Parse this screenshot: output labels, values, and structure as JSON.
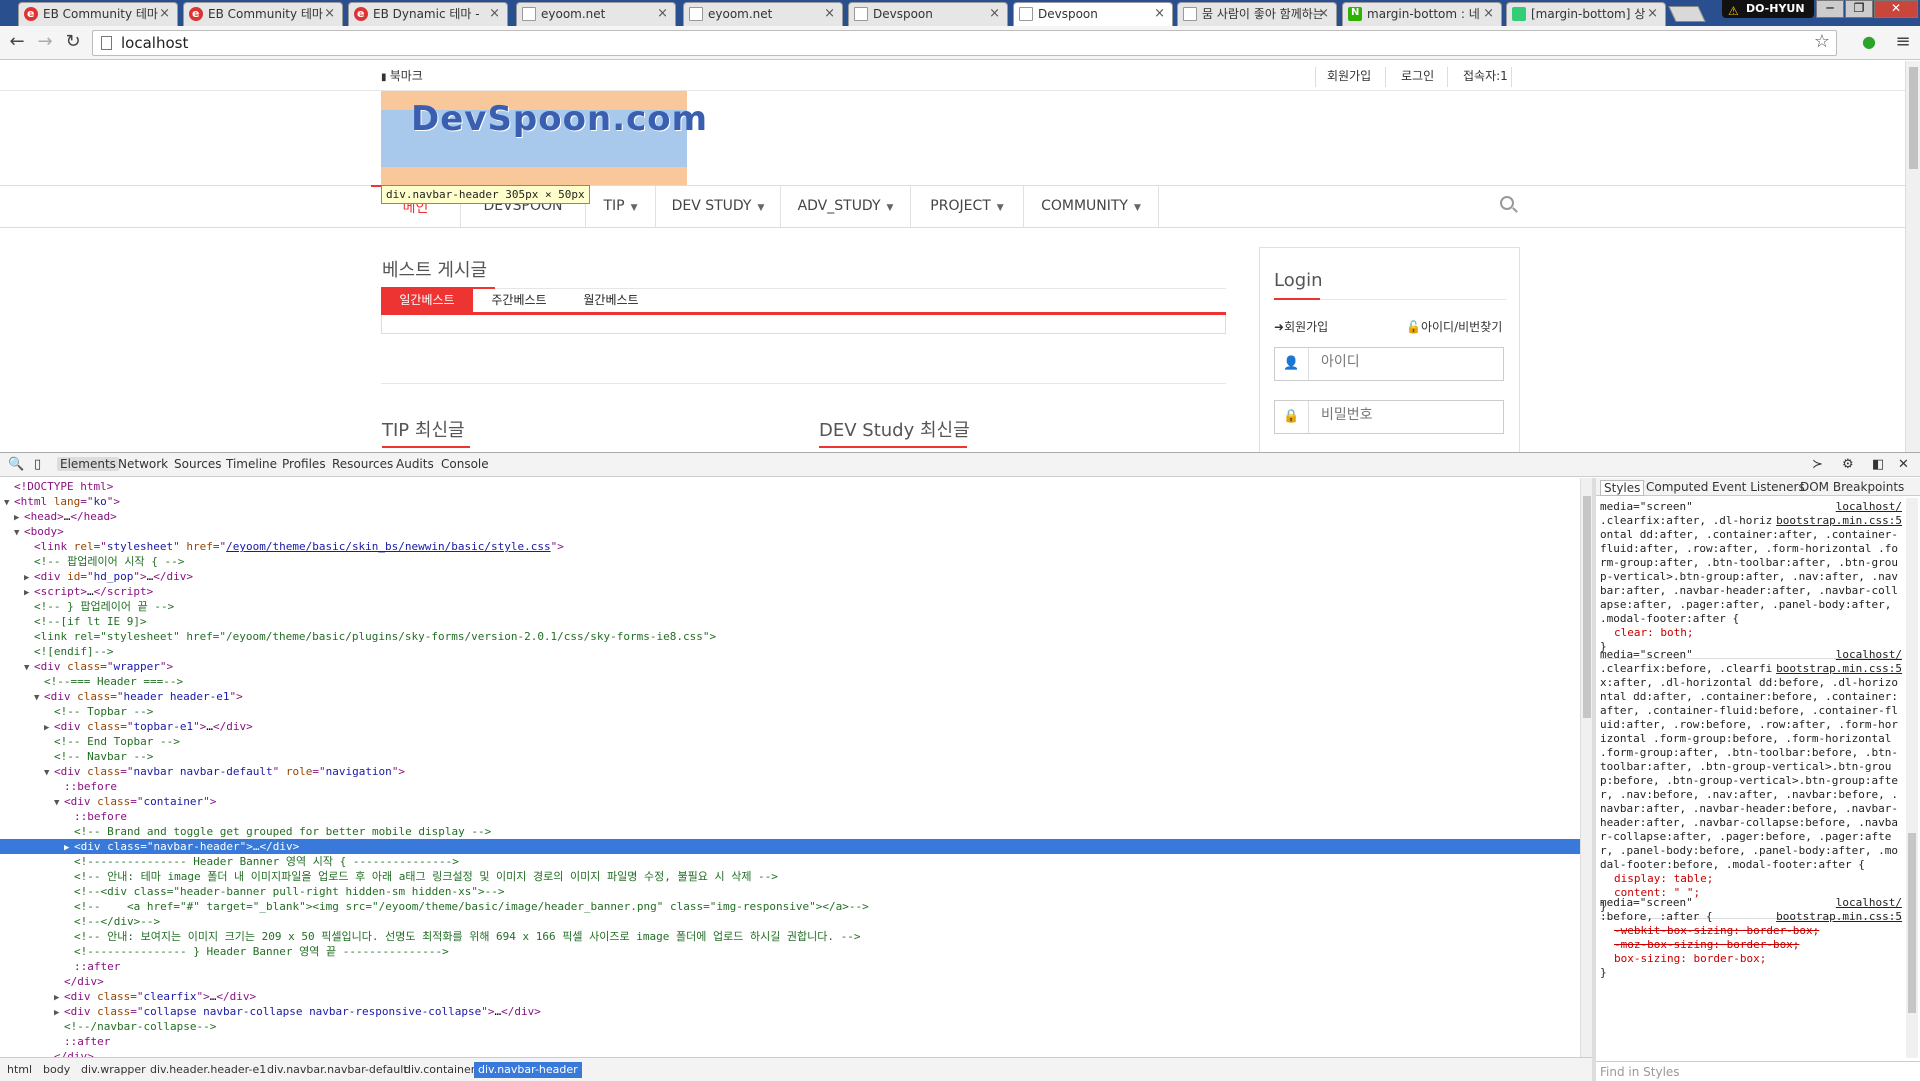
{
  "browser": {
    "tabs": [
      {
        "label": "EB Community 테마",
        "icon": "eyoom-icon"
      },
      {
        "label": "EB Community 테마",
        "icon": "eyoom-icon"
      },
      {
        "label": "EB Dynamic 테마 - ",
        "icon": "eyoom-icon"
      },
      {
        "label": "eyoom.net",
        "icon": "page-icon"
      },
      {
        "label": "eyoom.net",
        "icon": "page-icon"
      },
      {
        "label": "Devspoon",
        "icon": "page-icon"
      },
      {
        "label": "Devspoon",
        "icon": "page-icon"
      },
      {
        "label": "뭄 사람이 좋아 함께하는",
        "icon": "page-icon"
      },
      {
        "label": "margin-bottom : 네",
        "icon": "naver-icon"
      },
      {
        "label": "[margin-bottom] 상",
        "icon": "blog-icon"
      }
    ],
    "active_tab": 6,
    "user": "DO-HYUN",
    "url": "localhost",
    "window_buttons": {
      "minimize": "─",
      "maximize": "❐",
      "close": "✕"
    }
  },
  "site": {
    "topbar": {
      "bookmark": "북마크",
      "links": [
        "회원가입",
        "로그인",
        "접속자:1"
      ]
    },
    "logo_text": "DevSpoon.com",
    "nav": [
      {
        "label": "메인",
        "caret": false
      },
      {
        "label": "DEVSPOON",
        "caret": false
      },
      {
        "label": "TIP",
        "caret": true
      },
      {
        "label": "DEV STUDY",
        "caret": true
      },
      {
        "label": "ADV_STUDY",
        "caret": true
      },
      {
        "label": "PROJECT",
        "caret": true
      },
      {
        "label": "COMMUNITY",
        "caret": true
      }
    ],
    "tooltip": "div.navbar-header 305px × 50px",
    "best_title": "베스트 게시글",
    "best_tabs": [
      "일간베스트",
      "주간베스트",
      "월간베스트"
    ],
    "tip_title": "TIP 최신글",
    "dev_title": "DEV Study 최신글",
    "login": {
      "title": "Login",
      "signup": "회원가입",
      "find": "아이디/비번찾기",
      "id_placeholder": "아이디",
      "pw_placeholder": "비밀번호"
    }
  },
  "devtools": {
    "tabs": [
      "Elements",
      "Network",
      "Sources",
      "Timeline",
      "Profiles",
      "Resources",
      "Audits",
      "Console"
    ],
    "dom": [
      {
        "i": 0,
        "t": "",
        "h": "<span class=\"ps\">&lt;!DOCTYPE html&gt;</span>"
      },
      {
        "i": 0,
        "t": "▼",
        "h": "&lt;html <span class=\"at\">lang</span>=\"<span class=\"av\">ko</span>\"&gt;"
      },
      {
        "i": 1,
        "t": "▶",
        "h": "&lt;head&gt;<span class=\"tx\">…</span>&lt;/head&gt;"
      },
      {
        "i": 1,
        "t": "▼",
        "h": "&lt;body&gt;"
      },
      {
        "i": 2,
        "t": "",
        "h": "&lt;link <span class=\"at\">rel</span>=\"<span class=\"av\">stylesheet</span>\" <span class=\"at\">href</span>=\"<span class=\"lk\">/eyoom/theme/basic/skin_bs/newwin/basic/style.css</span>\"&gt;"
      },
      {
        "i": 2,
        "t": "",
        "h": "<span class=\"cm\">&lt;!-- 팝업레이어 시작 { --&gt;</span>"
      },
      {
        "i": 2,
        "t": "▶",
        "h": "&lt;div <span class=\"at\">id</span>=\"<span class=\"av\">hd_pop</span>\"&gt;<span class=\"tx\">…</span>&lt;/div&gt;"
      },
      {
        "i": 2,
        "t": "▶",
        "h": "&lt;script&gt;<span class=\"tx\">…</span>&lt;/script&gt;"
      },
      {
        "i": 2,
        "t": "",
        "h": "<span class=\"cm\">&lt;!-- } 팝업레이어 끝 --&gt;</span>"
      },
      {
        "i": 2,
        "t": "",
        "h": "<span class=\"cm\">&lt;!--[if lt IE 9]&gt;</span>"
      },
      {
        "i": 2,
        "t": "",
        "h": "<span class=\"cm\">&lt;link rel=\"stylesheet\" href=\"/eyoom/theme/basic/plugins/sky-forms/version-2.0.1/css/sky-forms-ie8.css\"&gt;</span>"
      },
      {
        "i": 2,
        "t": "",
        "h": "<span class=\"cm\">&lt;![endif]--&gt;</span>"
      },
      {
        "i": 2,
        "t": "▼",
        "h": "&lt;div <span class=\"at\">class</span>=\"<span class=\"av\">wrapper</span>\"&gt;"
      },
      {
        "i": 3,
        "t": "",
        "h": "<span class=\"cm\">&lt;!--=== Header ===--&gt;</span>"
      },
      {
        "i": 3,
        "t": "▼",
        "h": "&lt;div <span class=\"at\">class</span>=\"<span class=\"av\">header header-e1</span>\"&gt;"
      },
      {
        "i": 4,
        "t": "",
        "h": "<span class=\"cm\">&lt;!-- Topbar --&gt;</span>"
      },
      {
        "i": 4,
        "t": "▶",
        "h": "&lt;div <span class=\"at\">class</span>=\"<span class=\"av\">topbar-e1</span>\"&gt;<span class=\"tx\">…</span>&lt;/div&gt;"
      },
      {
        "i": 4,
        "t": "",
        "h": "<span class=\"cm\">&lt;!-- End Topbar --&gt;</span>"
      },
      {
        "i": 4,
        "t": "",
        "h": "<span class=\"cm\">&lt;!-- Navbar --&gt;</span>"
      },
      {
        "i": 4,
        "t": "▼",
        "h": "&lt;div <span class=\"at\">class</span>=\"<span class=\"av\">navbar navbar-default</span>\" <span class=\"at\">role</span>=\"<span class=\"av\">navigation</span>\"&gt;"
      },
      {
        "i": 5,
        "t": "",
        "h": "<span class=\"ps\">::before</span>"
      },
      {
        "i": 5,
        "t": "▼",
        "h": "&lt;div <span class=\"at\">class</span>=\"<span class=\"av\">container</span>\"&gt;"
      },
      {
        "i": 6,
        "t": "",
        "h": "<span class=\"ps\">::before</span>"
      },
      {
        "i": 6,
        "t": "",
        "h": "<span class=\"cm\">&lt;!-- Brand and toggle get grouped for better mobile display --&gt;</span>"
      },
      {
        "i": 6,
        "t": "▶",
        "h": "&lt;div <span class=\"at\">class</span>=\"<span class=\"av\">navbar-header</span>\"&gt;<span class=\"tx\">…</span>&lt;/div&gt;",
        "sel": true
      },
      {
        "i": 6,
        "t": "",
        "h": "<span class=\"cm\">&lt;!--------------- Header Banner 영역 시작 { ---------------&gt;</span>"
      },
      {
        "i": 6,
        "t": "",
        "h": "<span class=\"cm\">&lt;!-- 안내: 테마 image 폴더 내 이미지파일을 업로드 후 아래 a태그 링크설정 및 이미지 경로의 이미지 파일명 수정, 불필요 시 삭제 --&gt;</span>"
      },
      {
        "i": 6,
        "t": "",
        "h": "<span class=\"cm\">&lt;!--&lt;div class=\"header-banner pull-right hidden-sm hidden-xs\"&gt;--&gt;</span>"
      },
      {
        "i": 6,
        "t": "",
        "h": "<span class=\"cm\">&lt;!--    &lt;a href=\"#\" target=\"_blank\"&gt;&lt;img src=\"/eyoom/theme/basic/image/header_banner.png\" class=\"img-responsive\"&gt;&lt;/a&gt;--&gt;</span>"
      },
      {
        "i": 6,
        "t": "",
        "h": "<span class=\"cm\">&lt;!--&lt;/div&gt;--&gt;</span>"
      },
      {
        "i": 6,
        "t": "",
        "h": "<span class=\"cm\">&lt;!-- 안내: 보여지는 이미지 크기는 209 x 50 픽셀입니다. 선명도 최적화를 위해 694 x 166 픽셀 사이즈로 image 폴더에 업로드 하시길 권합니다. --&gt;</span>"
      },
      {
        "i": 6,
        "t": "",
        "h": "<span class=\"cm\">&lt;!--------------- } Header Banner 영역 끝 ---------------&gt;</span>"
      },
      {
        "i": 6,
        "t": "",
        "h": "<span class=\"ps\">::after</span>"
      },
      {
        "i": 5,
        "t": "",
        "h": "&lt;/div&gt;"
      },
      {
        "i": 5,
        "t": "▶",
        "h": "&lt;div <span class=\"at\">class</span>=\"<span class=\"av\">clearfix</span>\"&gt;<span class=\"tx\">…</span>&lt;/div&gt;"
      },
      {
        "i": 5,
        "t": "▶",
        "h": "&lt;div <span class=\"at\">class</span>=\"<span class=\"av\">collapse navbar-collapse navbar-responsive-collapse</span>\"&gt;<span class=\"tx\">…</span>&lt;/div&gt;"
      },
      {
        "i": 5,
        "t": "",
        "h": "<span class=\"cm\">&lt;!--/navbar-collapse--&gt;</span>"
      },
      {
        "i": 5,
        "t": "",
        "h": "<span class=\"ps\">::after</span>"
      },
      {
        "i": 4,
        "t": "",
        "h": "&lt;/div&gt;"
      }
    ],
    "styles_tabs": [
      "Styles",
      "Computed",
      "Event Listeners",
      "DOM Breakpoints"
    ],
    "styles": [
      {
        "media": "media=\"screen\"",
        "src": "localhost/",
        "file": "bootstrap.min.css:5",
        "sel": ".clearfix:after, .dl-horizontal dd:after, .container:after, .container-fluid:after, .row:after, .form-horizontal .form-group:after, .btn-toolbar:after, .btn-group-vertical>.btn-group:after, .nav:after, .navbar:after, .navbar-header:after, .navbar-collapse:after, .pager:after, .panel-body:after, .modal-footer:after {",
        "props": [
          [
            "clear",
            "both;"
          ]
        ]
      },
      {
        "media": "media=\"screen\"",
        "src": "localhost/",
        "file": "bootstrap.min.css:5",
        "sel": ".clearfix:before, .clearfix:after, .dl-horizontal dd:before, .dl-horizontal dd:after, .container:before, .container:after, .container-fluid:before, .container-fluid:after, .row:before, .row:after, .form-horizontal .form-group:before, .form-horizontal .form-group:after, .btn-toolbar:before, .btn-toolbar:after, .btn-group-vertical>.btn-group:before, .btn-group-vertical>.btn-group:after, .nav:before, .nav:after, .navbar:before, .navbar:after, .navbar-header:before, .navbar-header:after, .navbar-collapse:before, .navbar-collapse:after, .pager:before, .pager:after, .panel-body:before, .panel-body:after, .modal-footer:before, .modal-footer:after {",
        "props": [
          [
            "display",
            "table;"
          ],
          [
            "content",
            "\" \";"
          ]
        ]
      },
      {
        "media": "media=\"screen\"",
        "src": "localhost/",
        "file": "bootstrap.min.css:5",
        "sel": ":before, :after {",
        "props": [
          [
            "-webkit-box-sizing",
            "border-box;",
            true
          ],
          [
            "-moz-box-sizing",
            "border-box;",
            true
          ],
          [
            "box-sizing",
            "border-box;"
          ]
        ]
      }
    ],
    "find_placeholder": "Find in Styles",
    "breadcrumb": [
      "html",
      "body",
      "div.wrapper",
      "div.header.header-e1",
      "div.navbar.navbar-default",
      "div.container",
      "div.navbar-header"
    ]
  }
}
